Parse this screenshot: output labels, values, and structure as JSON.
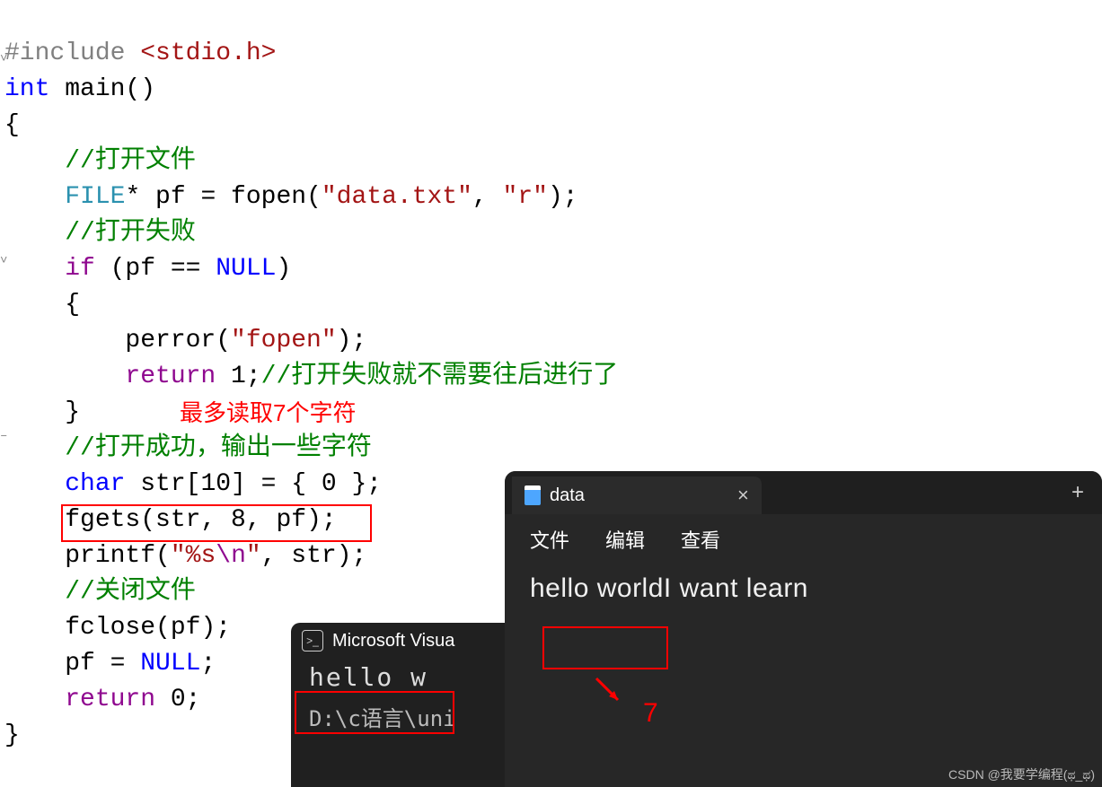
{
  "annotations": {
    "max_read": "最多读取7个字符",
    "digit": "7"
  },
  "code": {
    "include": "#include",
    "include_header": "<stdio.h>",
    "int": "int",
    "main": " main()",
    "lbrace": "{",
    "c_open_file": "//打开文件",
    "FILE": "FILE",
    "star_pf_eq": "* pf = fopen(",
    "str_data_txt": "\"data.txt\"",
    "comma1": ", ",
    "str_r": "\"r\"",
    "close_paren_semi": ");",
    "c_open_fail": "//打开失败",
    "if": "if",
    "cond_open": " (pf == ",
    "NULL1": "NULL",
    "cond_close": ")",
    "lbrace2": "{",
    "perror": "perror(",
    "str_fopen": "\"fopen\"",
    "perror_close": ");",
    "return": "return",
    "one_semi": " 1;",
    "c_return_fail": "//打开失败就不需要往后进行了",
    "rbrace2": "}",
    "c_open_ok": "//打开成功，输出一些字符",
    "char": "char",
    "strdecl": " str[10] = { 0 };",
    "fgets": "fgets(str, 8, pf);",
    "printf": "printf(",
    "fmt": "\"%s\\n\"",
    "fmt_nl_pre": "\"%s",
    "fmt_nl": "\\n",
    "fmt_nl_post": "\"",
    "printf_rest": ", str);",
    "c_close": "//关闭文件",
    "fclose": "fclose(pf);",
    "pf_eq": "pf = ",
    "NULL2": "NULL",
    "semi": ";",
    "return0": "return",
    "zero_semi": " 0;",
    "rbrace": "}"
  },
  "vs_window": {
    "title": "Microsoft Visua",
    "output": "hello w",
    "path_fragment": "D:\\c语言\\uni"
  },
  "notepad": {
    "tab_title": "data",
    "menu": {
      "file": "文件",
      "edit": "编辑",
      "view": "查看"
    },
    "content": "hello worldI want learn"
  },
  "watermark": "CSDN @我要学编程(ಥ_ಥ)"
}
